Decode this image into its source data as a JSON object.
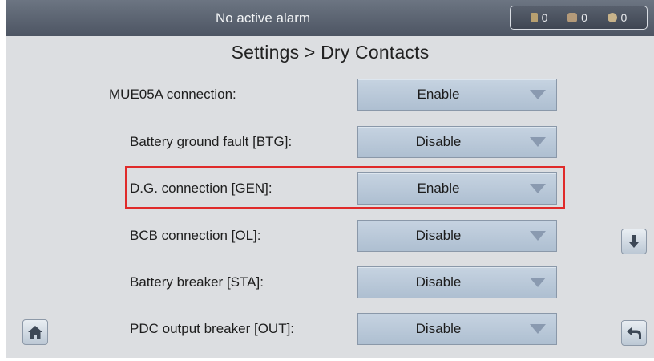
{
  "header": {
    "alarm_text": "No active alarm",
    "counters": [
      {
        "icon": "minor-alarm-icon",
        "count": "0"
      },
      {
        "icon": "major-alarm-icon",
        "count": "0"
      },
      {
        "icon": "critical-alarm-icon",
        "count": "0"
      }
    ]
  },
  "page_title": "Settings > Dry Contacts",
  "rows": [
    {
      "label": "MUE05A connection:",
      "value": "Enable"
    },
    {
      "label": "Battery ground fault [BTG]:",
      "value": "Disable"
    },
    {
      "label": "D.G. connection [GEN]:",
      "value": "Enable"
    },
    {
      "label": "BCB connection [OL]:",
      "value": "Disable"
    },
    {
      "label": "Battery breaker [STA]:",
      "value": "Disable"
    },
    {
      "label": "PDC output breaker [OUT]:",
      "value": "Disable"
    }
  ],
  "buttons": {
    "home_icon": "home-icon",
    "scroll_down_icon": "arrow-down-icon",
    "back_icon": "back-icon"
  },
  "colors": {
    "highlight": "#e02a2a",
    "dropdown_bg": "#b8c8d9",
    "top_bar": "#5a6270"
  }
}
